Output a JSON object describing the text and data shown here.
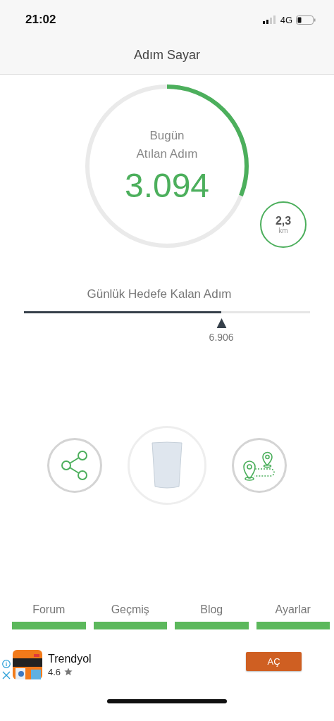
{
  "status_bar": {
    "time": "21:02",
    "network": "4G"
  },
  "nav": {
    "title": "Adım Sayar"
  },
  "today": {
    "label_1": "Bugün",
    "label_2": "Atılan Adım",
    "steps": "3.094",
    "level": 0.31
  },
  "distance": {
    "value": "2,3",
    "unit": "km"
  },
  "goal": {
    "label": "Günlük Hedefe Kalan Adım",
    "level": 0.69,
    "remaining": "6.906"
  },
  "tabs": [
    {
      "label": "Forum"
    },
    {
      "label": "Geçmiş"
    },
    {
      "label": "Blog"
    },
    {
      "label": "Ayarlar"
    }
  ],
  "ad": {
    "app": "Trendyol",
    "rating": "4.6",
    "action": "AÇ"
  }
}
